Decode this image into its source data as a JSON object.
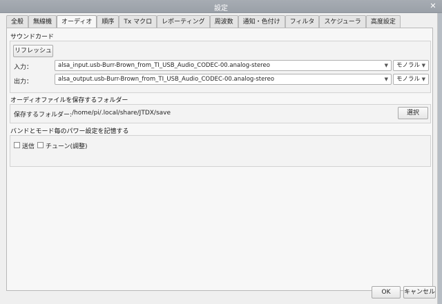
{
  "window": {
    "title": "設定",
    "close_glyph": "✕"
  },
  "tabs": [
    {
      "label": "全般"
    },
    {
      "label": "無線機"
    },
    {
      "label": "オーディオ",
      "active": true
    },
    {
      "label": "順序"
    },
    {
      "label": "Tx マクロ"
    },
    {
      "label": "レポーティング"
    },
    {
      "label": "周波数"
    },
    {
      "label": "通知・色付け"
    },
    {
      "label": "フィルタ"
    },
    {
      "label": "スケジューラ"
    },
    {
      "label": "高度設定"
    }
  ],
  "soundcard": {
    "title": "サウンドカード",
    "refresh_label": "リフレッシュ",
    "input_label": "入力：",
    "input_value": "alsa_input.usb-Burr-Brown_from_TI_USB_Audio_CODEC-00.analog-stereo",
    "input_channel": "モノラル",
    "output_label": "出力：",
    "output_value": "alsa_output.usb-Burr-Brown_from_TI_USB_Audio_CODEC-00.analog-stereo",
    "output_channel": "モノラル"
  },
  "save_folder": {
    "title": "オーディオファイルを保存するフォルダー",
    "label": "保存するフォルダー:",
    "path": "/home/pi/.local/share/JTDX/save",
    "select_label": "選択"
  },
  "power": {
    "title": "バンドとモード毎のパワー設定を記憶する",
    "tx_label": "送信",
    "tune_label": "チューン(調整)"
  },
  "footer": {
    "ok_label": "OK",
    "cancel_label": "キャンセル"
  }
}
